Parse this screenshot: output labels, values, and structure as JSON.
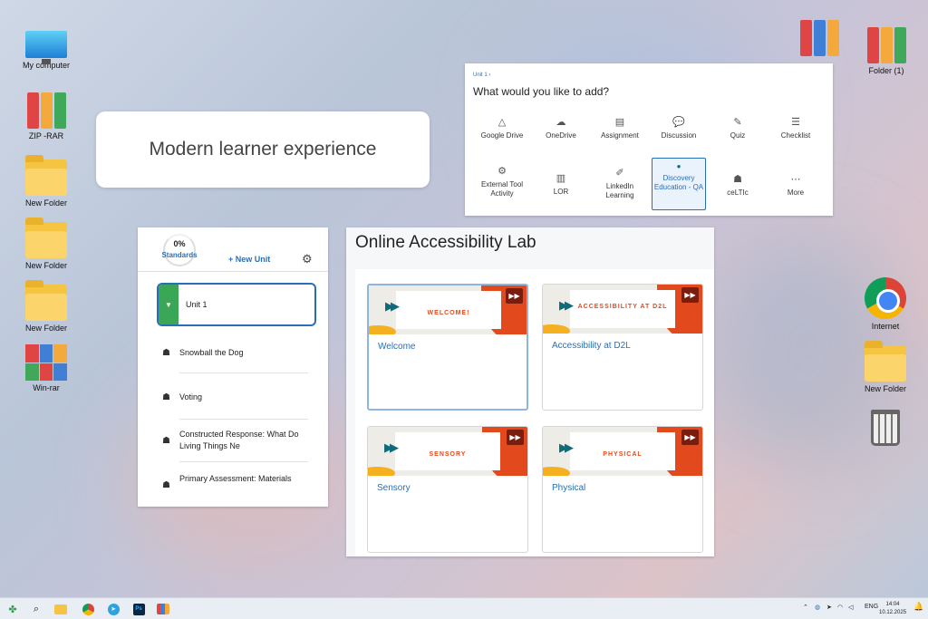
{
  "desktop_left": [
    {
      "label": "My computer"
    },
    {
      "label": "ZIP -RAR"
    },
    {
      "label": "New Folder"
    },
    {
      "label": "New Folder"
    },
    {
      "label": "New Folder"
    },
    {
      "label": "Win-rar"
    }
  ],
  "desktop_right": [
    {
      "label": "Folder (1)"
    },
    {
      "label": "Internet"
    },
    {
      "label": "New Folder"
    }
  ],
  "hero": {
    "text": "Modern learner experience"
  },
  "add_panel": {
    "breadcrumb": "Unit 1 ›",
    "question": "What would you like to add?",
    "tools": [
      {
        "label": "Google Drive",
        "icon": "google-drive-icon",
        "glyph": "△"
      },
      {
        "label": "OneDrive",
        "icon": "onedrive-icon",
        "glyph": "☁"
      },
      {
        "label": "Assignment",
        "icon": "assignment-icon",
        "glyph": "▤"
      },
      {
        "label": "Discussion",
        "icon": "discussion-icon",
        "glyph": "💬"
      },
      {
        "label": "Quiz",
        "icon": "quiz-icon",
        "glyph": "✎"
      },
      {
        "label": "Checklist",
        "icon": "checklist-icon",
        "glyph": "☰"
      },
      {
        "label": "External Tool Activity",
        "icon": "external-tool-icon",
        "glyph": "⚙"
      },
      {
        "label": "LOR",
        "icon": "lor-icon",
        "glyph": "▥"
      },
      {
        "label": "LinkedIn Learning",
        "icon": "linkedin-icon",
        "glyph": "✐"
      },
      {
        "label": "Discovery Education - QA",
        "icon": "discovery-icon",
        "glyph": "●"
      },
      {
        "label": "ceLTIc",
        "icon": "celtic-icon",
        "glyph": "☗"
      },
      {
        "label": "More",
        "icon": "more-icon",
        "glyph": "⋯"
      }
    ]
  },
  "unit_panel": {
    "percent": "0%",
    "standards_label": "Standards",
    "new_unit_label": "+ New Unit",
    "unit_name": "Unit 1",
    "items": [
      {
        "label": "Snowball the Dog"
      },
      {
        "label": "Voting"
      },
      {
        "label": "Constructed Response: What Do Living Things Ne"
      },
      {
        "label": "Primary Assessment: Materials"
      }
    ]
  },
  "lab_panel": {
    "title": "Online Accessibility Lab",
    "cards": [
      {
        "thumb_text": "WELCOME!",
        "label": "Welcome"
      },
      {
        "thumb_text": "ACCESSIBILITY AT D2L",
        "label": "Accessibility at D2L"
      },
      {
        "thumb_text": "SENSORY",
        "label": "Sensory"
      },
      {
        "thumb_text": "PHYSICAL",
        "label": "Physical"
      }
    ]
  },
  "taskbar": {
    "language": "ENG",
    "time": "14:04",
    "date": "10.12.2025",
    "apps": [
      "start-icon",
      "search-icon",
      "file-explorer-icon",
      "chrome-icon",
      "telegram-icon",
      "photoshop-icon",
      "winrar-icon"
    ]
  },
  "colors": {
    "accent": "#2a6fb5",
    "d2l_orange": "#e24a1e",
    "unit_green": "#3aa757"
  }
}
